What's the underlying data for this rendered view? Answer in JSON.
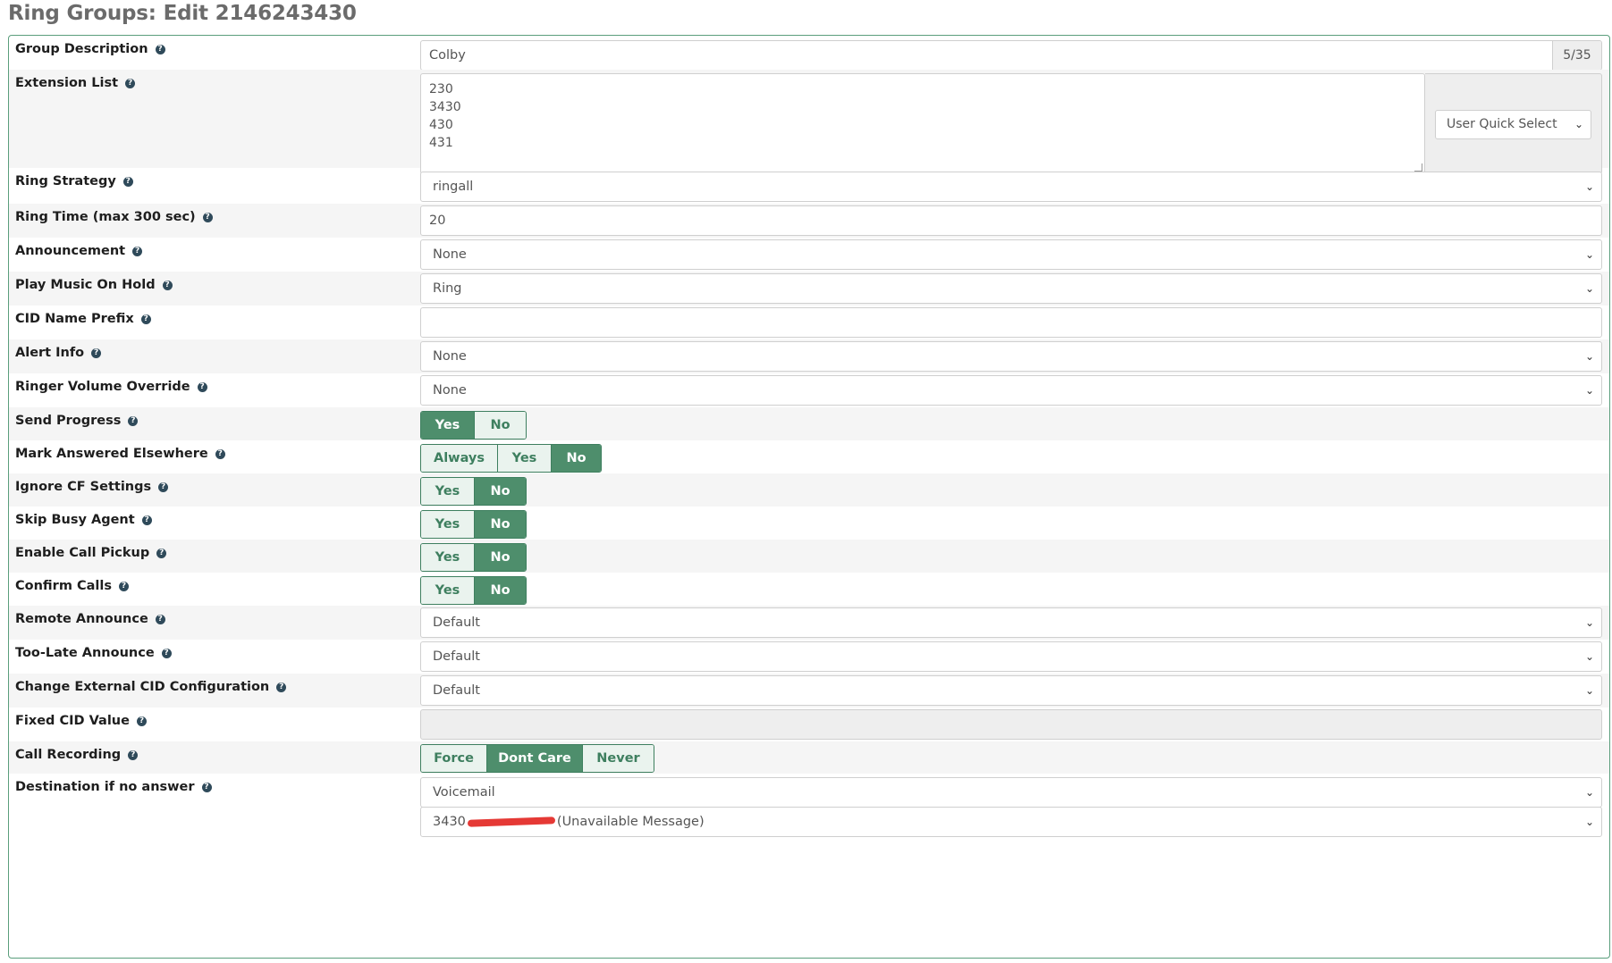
{
  "page": {
    "title": "Ring Groups: Edit 2146243430"
  },
  "fields": {
    "group_description": {
      "label": "Group Description",
      "value": "Colby",
      "counter": "5/35"
    },
    "extension_list": {
      "label": "Extension List",
      "value": "230\n3430\n430\n431",
      "quick_select": "User Quick Select"
    },
    "ring_strategy": {
      "label": "Ring Strategy",
      "value": "ringall"
    },
    "ring_time": {
      "label": "Ring Time (max 300 sec)",
      "value": "20"
    },
    "announcement": {
      "label": "Announcement",
      "value": "None"
    },
    "play_moh": {
      "label": "Play Music On Hold",
      "value": "Ring"
    },
    "cid_name_prefix": {
      "label": "CID Name Prefix",
      "value": ""
    },
    "alert_info": {
      "label": "Alert Info",
      "value": "None"
    },
    "ringer_volume": {
      "label": "Ringer Volume Override",
      "value": "None"
    },
    "send_progress": {
      "label": "Send Progress",
      "options": [
        "Yes",
        "No"
      ],
      "selected": "Yes"
    },
    "mark_answered": {
      "label": "Mark Answered Elsewhere",
      "options": [
        "Always",
        "Yes",
        "No"
      ],
      "selected": "No"
    },
    "ignore_cf": {
      "label": "Ignore CF Settings",
      "options": [
        "Yes",
        "No"
      ],
      "selected": "No"
    },
    "skip_busy": {
      "label": "Skip Busy Agent",
      "options": [
        "Yes",
        "No"
      ],
      "selected": "No"
    },
    "call_pickup": {
      "label": "Enable Call Pickup",
      "options": [
        "Yes",
        "No"
      ],
      "selected": "No"
    },
    "confirm_calls": {
      "label": "Confirm Calls",
      "options": [
        "Yes",
        "No"
      ],
      "selected": "No"
    },
    "remote_announce": {
      "label": "Remote Announce",
      "value": "Default"
    },
    "too_late_announce": {
      "label": "Too-Late Announce",
      "value": "Default"
    },
    "change_ext_cid": {
      "label": "Change External CID Configuration",
      "value": "Default"
    },
    "fixed_cid": {
      "label": "Fixed CID Value",
      "value": ""
    },
    "call_recording": {
      "label": "Call Recording",
      "options": [
        "Force",
        "Dont Care",
        "Never"
      ],
      "selected": "Dont Care"
    },
    "destination": {
      "label": "Destination if no answer",
      "type_value": "Voicemail",
      "target_prefix": "3430",
      "target_suffix": "(Unavailable Message)"
    }
  },
  "icons": {
    "help": "question-circle-icon",
    "dropdown": "chevron-down-icon"
  },
  "colors": {
    "accent": "#4e8e6c",
    "border": "#5a9e7c",
    "title": "#6b6b6b"
  }
}
